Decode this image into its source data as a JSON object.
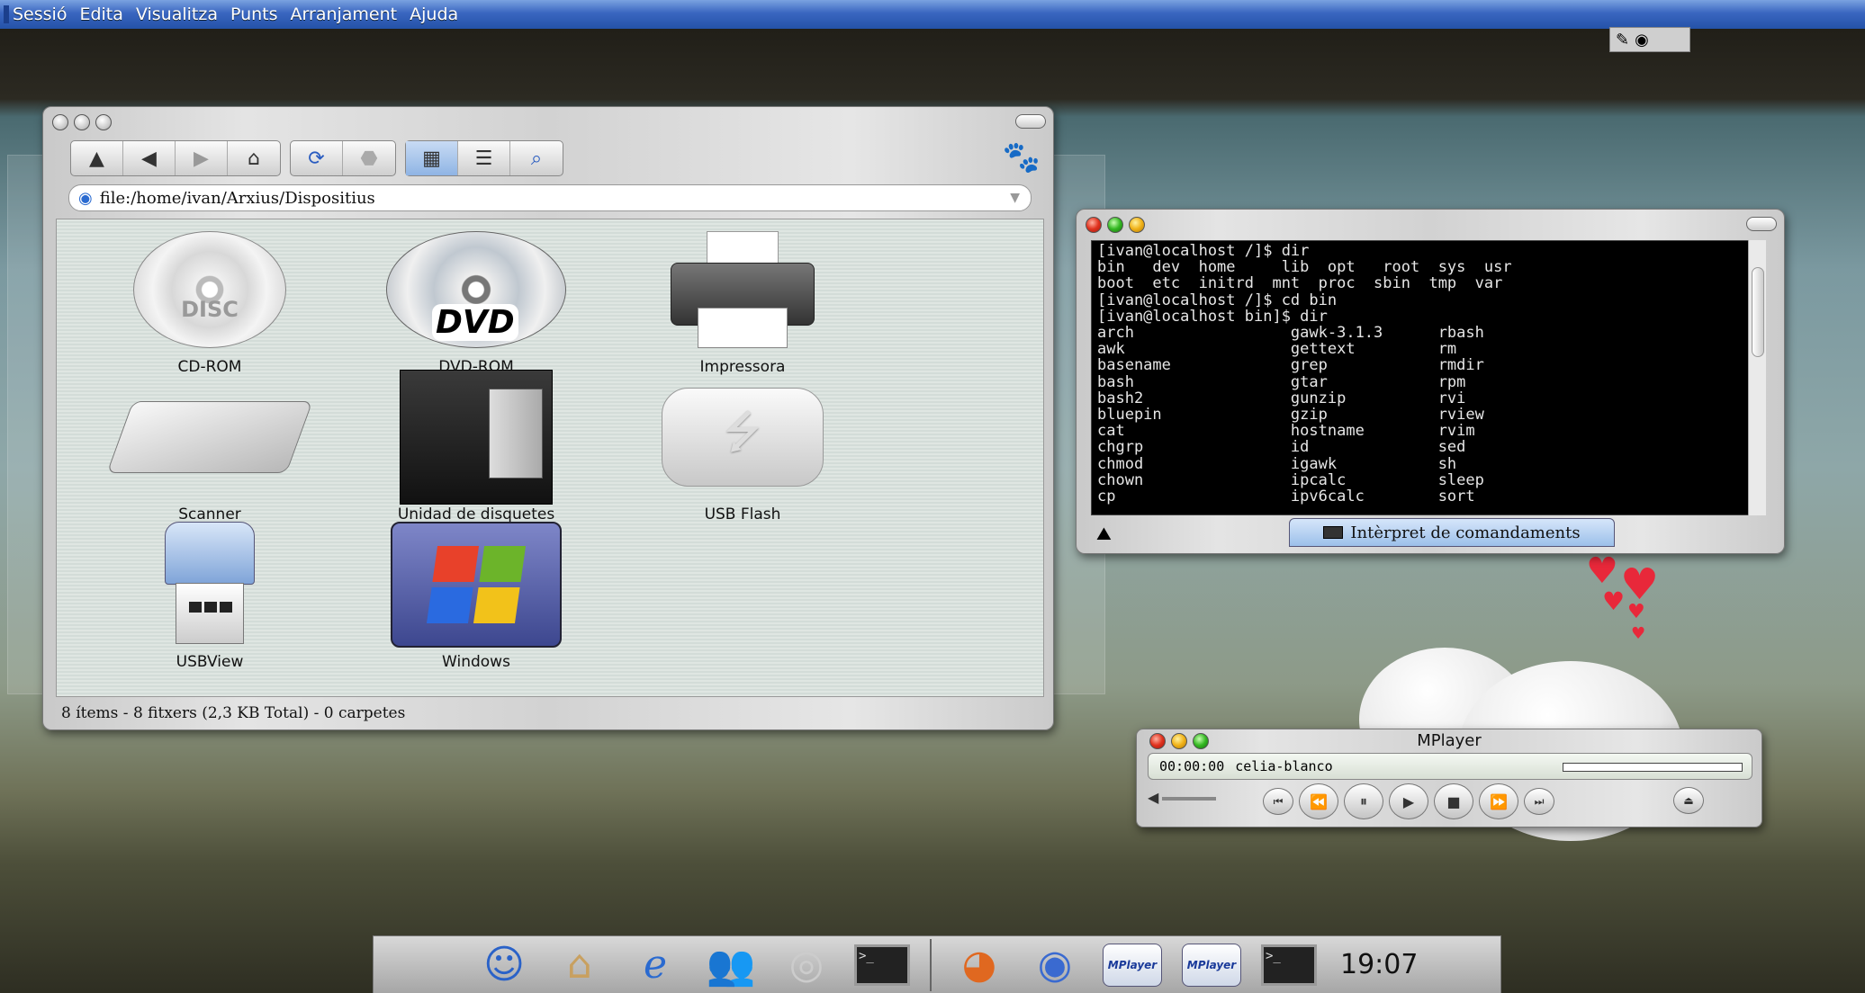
{
  "menubar": {
    "items": [
      "Sessió",
      "Edita",
      "Visualitza",
      "Punts",
      "Arranjament",
      "Ajuda"
    ]
  },
  "file_manager": {
    "location": "file:/home/ivan/Arxius/Dispositius",
    "items": [
      {
        "label": "CD-ROM",
        "icon": "cdrom-icon"
      },
      {
        "label": "DVD-ROM",
        "icon": "dvd-icon"
      },
      {
        "label": "Impressora",
        "icon": "printer-icon"
      },
      {
        "label": "Scanner",
        "icon": "scanner-icon"
      },
      {
        "label": "Unidad de disquetes",
        "icon": "floppy-icon"
      },
      {
        "label": "USB Flash",
        "icon": "usb-drive-icon"
      },
      {
        "label": "USBView",
        "icon": "usb-stick-icon"
      },
      {
        "label": "Windows",
        "icon": "windows-drive-icon"
      }
    ],
    "status": "8 ítems - 8 fitxers (2,3 KB Total) - 0 carpetes"
  },
  "terminal": {
    "lines": [
      "[ivan@localhost /]$ dir",
      "bin   dev  home     lib  opt   root  sys  usr",
      "boot  etc  initrd  mnt  proc  sbin  tmp  var",
      "[ivan@localhost /]$ cd bin",
      "[ivan@localhost bin]$ dir",
      "arch                 gawk-3.1.3      rbash",
      "awk                  gettext         rm",
      "basename             grep            rmdir",
      "bash                 gtar            rpm",
      "bash2                gunzip          rvi",
      "bluepin              gzip            rview",
      "cat                  hostname        rvim",
      "chgrp                id              sed",
      "chmod                igawk           sh",
      "chown                ipcalc          sleep",
      "cp                   ipv6calc        sort"
    ],
    "tab_label": "Intèrpret de comandaments"
  },
  "mplayer": {
    "title": "MPlayer",
    "time": "00:00:00",
    "track": "celia-blanco"
  },
  "dock": {
    "mplayer_badge": "MPlayer",
    "clock": "19:07"
  }
}
